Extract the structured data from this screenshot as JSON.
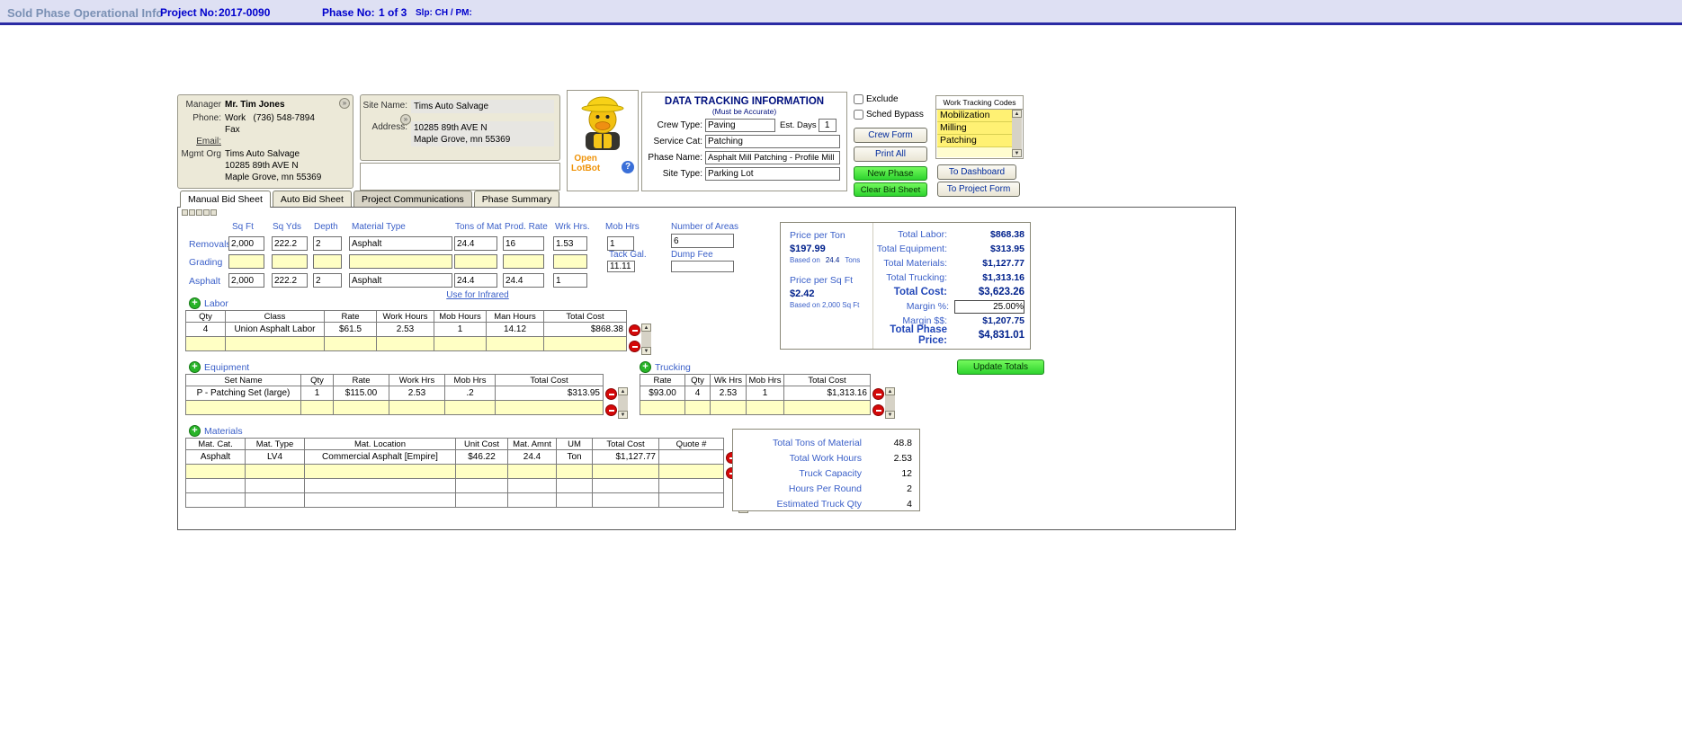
{
  "colors": {
    "topbar_bg": "#dee0f3",
    "title_text": "#7a90b4",
    "project_text": "#0000cc",
    "panel_beige": "#ece9d8",
    "label_blue": "#3a5fc8",
    "navy": "#00218c",
    "input_yellow": "#ffffc4",
    "list_highlight": "#fff173",
    "button_green": "#2ed32e",
    "minus_red": "#d40808",
    "lotbot_orange": "#ef9309"
  },
  "icons": {
    "expand": "»",
    "help": "?",
    "up": "▲",
    "down": "▼"
  },
  "top_bar": {
    "title": "Sold Phase Operational Info",
    "project_no_label": "Project No:",
    "project_no_value": "2017-0090",
    "phase_no_label": "Phase No:",
    "phase_no_value": "1 of 3",
    "slp_text": "Slp: CH / PM:"
  },
  "manager": {
    "label": "Manager",
    "name": "Mr. Tim Jones",
    "phone_label": "Phone:",
    "phone_type": "Work",
    "phone_number": "(736) 548-7894",
    "fax_label": "Fax",
    "email_label": "Email:",
    "mgmt_org_label": "Mgmt Org",
    "org_name": "Tims Auto Salvage",
    "org_address1": "10285 89th AVE N",
    "org_address2": "Maple Grove, mn 55369"
  },
  "site": {
    "name_label": "Site Name:",
    "name_value": "Tims Auto Salvage",
    "address_label": "Address:",
    "address_line1": "10285 89th AVE N",
    "address_line2": "Maple Grove, mn 55369",
    "notes_value": ""
  },
  "lotbot": {
    "open_line1": "Open",
    "open_line2": "LotBot"
  },
  "data_tracking": {
    "title": "DATA TRACKING INFORMATION",
    "subtitle": "(Must be Accurate)",
    "crew_type_label": "Crew Type:",
    "crew_type_value": "Paving",
    "est_days_label": "Est. Days",
    "est_days_value": "1",
    "service_cat_label": "Service Cat:",
    "service_cat_value": "Patching",
    "phase_name_label": "Phase Name:",
    "phase_name_value": "Asphalt Mill Patching - Profile Mill",
    "site_type_label": "Site Type:",
    "site_type_value": "Parking Lot"
  },
  "controls": {
    "exclude_label": "Exclude",
    "sched_bypass_label": "Sched Bypass",
    "crew_form": "Crew Form",
    "print_all": "Print All",
    "new_phase": "New Phase",
    "clear_bid_sheet": "Clear Bid Sheet",
    "to_dashboard": "To Dashboard",
    "to_project_form": "To Project Form"
  },
  "work_tracking": {
    "title": "Work Tracking Codes",
    "items": [
      "Mobilization",
      "Milling",
      "Patching"
    ]
  },
  "tabs": {
    "manual": "Manual Bid Sheet",
    "auto": "Auto Bid Sheet",
    "comms": "Project Communications",
    "summary": "Phase Summary"
  },
  "bid_grid": {
    "headers": {
      "sq_ft": "Sq Ft",
      "sq_yds": "Sq Yds",
      "depth": "Depth",
      "material_type": "Material Type",
      "tons_of_mat": "Tons of Mat",
      "prod_rate": "Prod. Rate",
      "wrk_hrs": "Wrk Hrs.",
      "mob_hrs": "Mob Hrs",
      "number_of_areas": "Number of Areas",
      "tack_gal": "Tack Gal.",
      "dump_fee": "Dump Fee"
    },
    "removals": {
      "label": "Removals",
      "sq_ft": "2,000",
      "sq_yds": "222.2",
      "depth": "2",
      "material": "Asphalt",
      "tons": "24.4",
      "prod_rate": "16",
      "wrk_hrs": "1.53",
      "mob_hrs": "1"
    },
    "grading": {
      "label": "Grading",
      "sq_ft": "",
      "sq_yds": "",
      "depth": "",
      "material": "",
      "tons": "",
      "prod_rate": "",
      "wrk_hrs": ""
    },
    "asphalt": {
      "label": "Asphalt",
      "sq_ft": "2,000",
      "sq_yds": "222.2",
      "depth": "2",
      "material": "Asphalt",
      "tons": "24.4",
      "prod_rate": "24.4",
      "wrk_hrs": "1"
    },
    "number_of_areas_value": "6",
    "tack_gal_value": "11.11",
    "dump_fee_value": "",
    "infrared_link": "Use for Infrared"
  },
  "labor": {
    "section": "Labor",
    "headers": [
      "Qty",
      "Class",
      "Rate",
      "Work Hours",
      "Mob Hours",
      "Man Hours",
      "Total Cost"
    ],
    "row": [
      "4",
      "Union Asphalt Labor",
      "$61.5",
      "2.53",
      "1",
      "14.12",
      "$868.38"
    ]
  },
  "equipment": {
    "section": "Equipment",
    "headers": [
      "Set Name",
      "Qty",
      "Rate",
      "Work Hrs",
      "Mob Hrs",
      "Total Cost"
    ],
    "row": [
      "P - Patching Set (large)",
      "1",
      "$115.00",
      "2.53",
      ".2",
      "$313.95"
    ]
  },
  "trucking": {
    "section": "Trucking",
    "headers": [
      "Rate",
      "Qty",
      "Wk Hrs",
      "Mob Hrs",
      "Total Cost"
    ],
    "row": [
      "$93.00",
      "4",
      "2.53",
      "1",
      "$1,313.16"
    ]
  },
  "materials": {
    "section": "Materials",
    "headers": [
      "Mat. Cat.",
      "Mat. Type",
      "Mat. Location",
      "Unit Cost",
      "Mat. Amnt",
      "UM",
      "Total Cost",
      "Quote #"
    ],
    "row": [
      "Asphalt",
      "LV4",
      "Commercial Asphalt [Empire]",
      "$46.22",
      "24.4",
      "Ton",
      "$1,127.77",
      ""
    ]
  },
  "pricing": {
    "price_per_ton_label": "Price per Ton",
    "price_per_ton": "$197.99",
    "ton_basis_prefix": "Based on",
    "ton_basis_value": "24.4",
    "ton_basis_unit": "Tons",
    "price_per_sqft_label": "Price per Sq Ft",
    "price_per_sqft": "$2.42",
    "sqft_basis": "Based on 2,000 Sq Ft",
    "total_labor_label": "Total Labor:",
    "total_labor": "$868.38",
    "total_equipment_label": "Total Equipment:",
    "total_equipment": "$313.95",
    "total_materials_label": "Total Materials:",
    "total_materials": "$1,127.77",
    "total_trucking_label": "Total Trucking:",
    "total_trucking": "$1,313.16",
    "total_cost_label": "Total Cost:",
    "total_cost": "$3,623.26",
    "margin_pct_label": "Margin %:",
    "margin_pct_value": "25.00%",
    "margin_dollars_label": "Margin $$:",
    "margin_dollars": "$1,207.75",
    "total_phase_price_label": "Total Phase Price:",
    "total_phase_price": "$4,831.01",
    "update_totals": "Update Totals"
  },
  "stats": {
    "rows": [
      {
        "label": "Total Tons of Material",
        "value": "48.8"
      },
      {
        "label": "Total Work Hours",
        "value": "2.53"
      },
      {
        "label": "Truck Capacity",
        "value": "12"
      },
      {
        "label": "Hours Per Round",
        "value": "2"
      },
      {
        "label": "Estimated Truck Qty",
        "value": "4"
      }
    ]
  }
}
